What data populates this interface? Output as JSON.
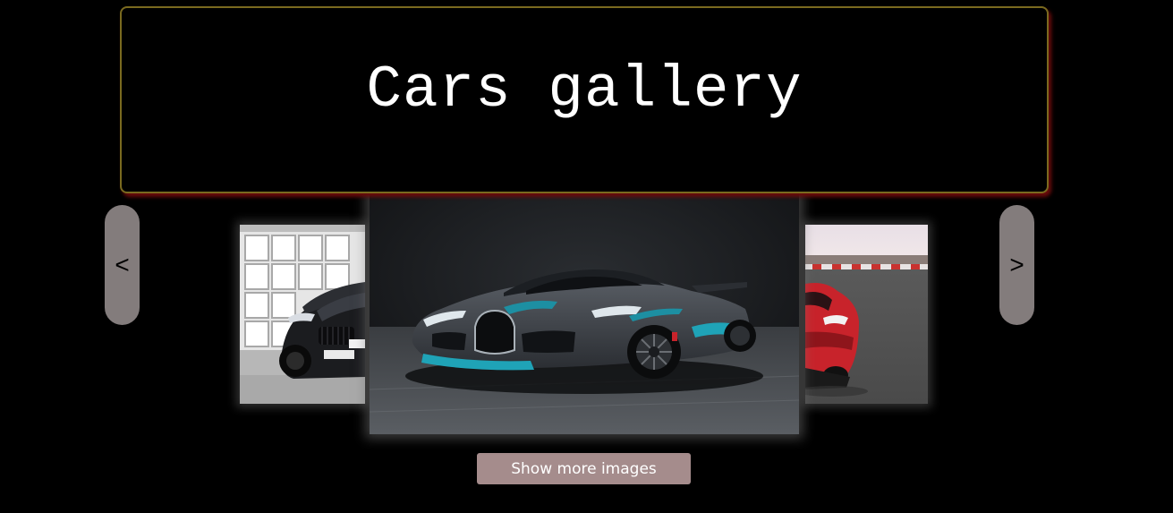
{
  "header": {
    "title": "Cars gallery"
  },
  "gallery": {
    "prev_label": "<",
    "next_label": ">",
    "slides": [
      {
        "position": "left",
        "subject": "black BMW M8 coupe in front of white garage"
      },
      {
        "position": "center",
        "subject": "dark grey and teal Bugatti Divo supercar"
      },
      {
        "position": "right",
        "subject": "red Ferrari SF90 on race track"
      }
    ]
  },
  "actions": {
    "show_more_label": "Show more images"
  },
  "colors": {
    "background": "#000000",
    "header_border": "#7a6a1f",
    "header_shadow": "#6b0b0b",
    "nav_button": "#837c7c",
    "show_more_button": "#a58c8c"
  }
}
